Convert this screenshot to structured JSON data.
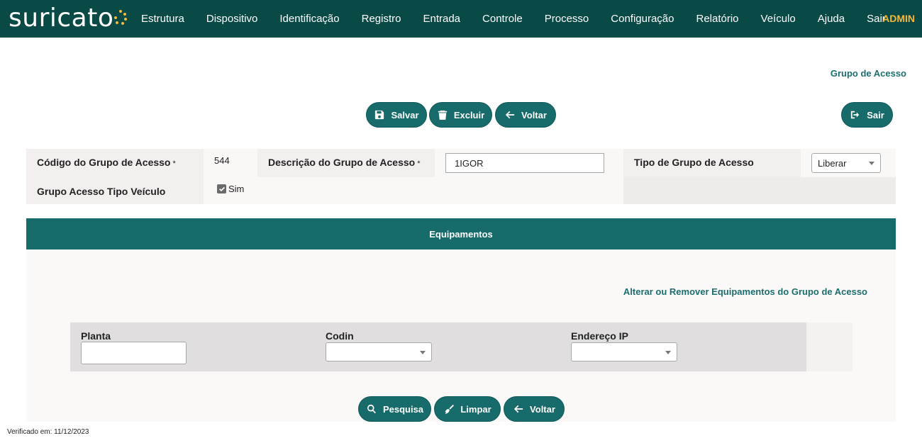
{
  "app": {
    "logo_text": "suricato",
    "brand_color": "#0a4a46",
    "accent_color": "#f5b83a"
  },
  "nav": {
    "items": [
      "Estrutura",
      "Dispositivo",
      "Identificação",
      "Registro",
      "Entrada",
      "Controle",
      "Processo",
      "Configuração",
      "Relatório",
      "Veículo",
      "Ajuda",
      "Sair"
    ],
    "user": "ADMIN"
  },
  "page": {
    "title": "Grupo de Acesso"
  },
  "toolbar": {
    "save_label": "Salvar",
    "delete_label": "Excluir",
    "back_label": "Voltar",
    "exit_label": "Sair"
  },
  "form": {
    "codigo_label": "Código do Grupo de Acesso",
    "codigo_value": "544",
    "descricao_label": "Descrição do Grupo de Acesso",
    "descricao_value": "1IGOR",
    "tipo_label": "Tipo de Grupo de Acesso",
    "tipo_value": "Liberar",
    "veiculo_label": "Grupo Acesso Tipo Veículo",
    "veiculo_checked": true,
    "veiculo_option": "Sim",
    "required_mark": "*"
  },
  "equipamentos": {
    "header": "Equipamentos",
    "link": "Alterar ou Remover Equipamentos do Grupo de Acesso",
    "filters": {
      "planta_label": "Planta",
      "planta_value": "",
      "codin_label": "Codin",
      "codin_value": "",
      "ip_label": "Endereço IP",
      "ip_value": ""
    },
    "search_label": "Pesquisa",
    "clear_label": "Limpar",
    "back_label": "Voltar"
  },
  "footer": {
    "verified": "Verificado em: 11/12/2023"
  }
}
